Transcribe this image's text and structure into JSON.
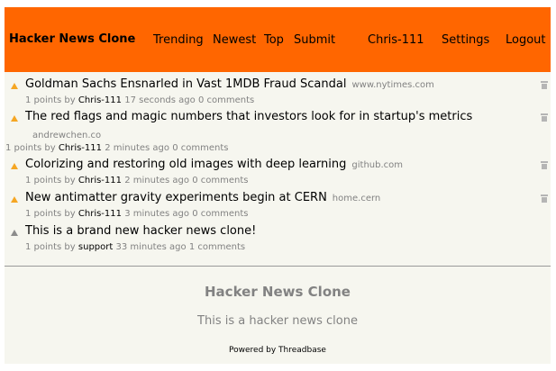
{
  "header": {
    "brand": "Hacker News Clone",
    "nav": [
      "Trending",
      "Newest",
      "Top",
      "Submit"
    ],
    "user": "Chris-111",
    "settings": "Settings",
    "logout": "Logout"
  },
  "stories": [
    {
      "title": "Goldman Sachs Ensnarled in Vast 1MDB Fraud Scandal",
      "domain": "www.nytimes.com",
      "points": "1 points by",
      "user": "Chris-111",
      "time": "17 seconds ago",
      "comments": "0 comments"
    },
    {
      "title": "The red flags and magic numbers that investors look for in startup's metrics",
      "domain": "andrewchen.co",
      "points": "1 points by",
      "user": "Chris-111",
      "time": "2 minutes ago",
      "comments": "0 comments"
    },
    {
      "title": "Colorizing and restoring old images with deep learning",
      "domain": "github.com",
      "points": "1 points by",
      "user": "Chris-111",
      "time": "2 minutes ago",
      "comments": "0 comments"
    },
    {
      "title": "New antimatter gravity experiments begin at CERN",
      "domain": "home.cern",
      "points": "1 points by",
      "user": "Chris-111",
      "time": "3 minutes ago",
      "comments": "0 comments"
    },
    {
      "title": "This is a brand new hacker news clone!",
      "domain": "",
      "points": "1 points by",
      "user": "support",
      "time": "33 minutes ago",
      "comments": "1 comments"
    }
  ],
  "footer": {
    "title": "Hacker News Clone",
    "subtitle": "This is a hacker news clone",
    "powered": "Powered by Threadbase"
  },
  "colors": {
    "header": "#ff6600",
    "background": "#f6f6ef",
    "upvote": "#f5a623",
    "muted": "#828282"
  },
  "icons": {
    "upvote": "triangle-up-icon",
    "delete": "trash-icon"
  }
}
